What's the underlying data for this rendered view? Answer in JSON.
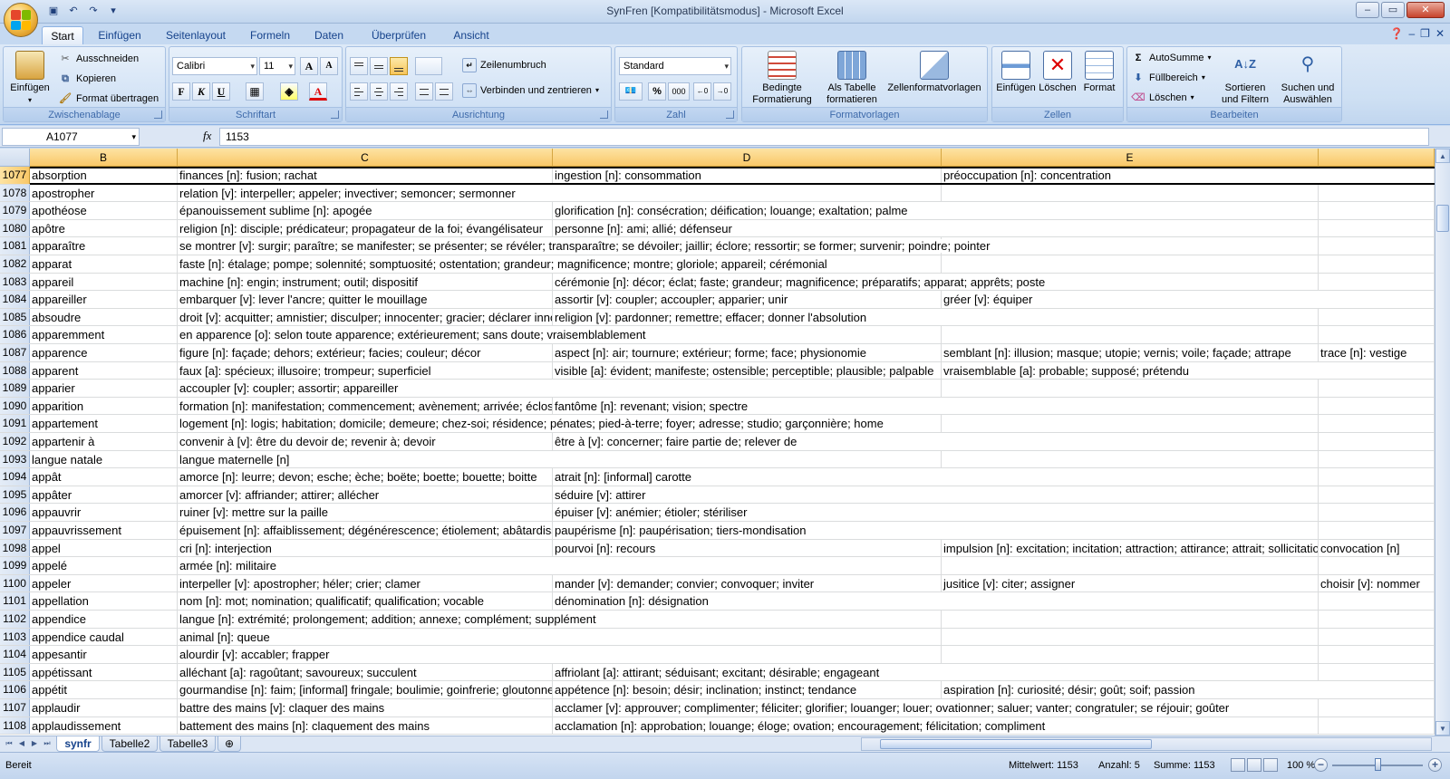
{
  "window": {
    "title": "SynFren  [Kompatibilitätsmodus] - Microsoft Excel"
  },
  "ribbon": {
    "tabs": [
      "Start",
      "Einfügen",
      "Seitenlayout",
      "Formeln",
      "Daten",
      "Überprüfen",
      "Ansicht"
    ],
    "active_tab": "Start",
    "clipboard": {
      "group_label": "Zwischenablage",
      "paste": "Einfügen",
      "cut": "Ausschneiden",
      "copy": "Kopieren",
      "format_painter": "Format übertragen"
    },
    "font": {
      "group_label": "Schriftart",
      "font_name": "Calibri",
      "font_size": "11"
    },
    "alignment": {
      "group_label": "Ausrichtung",
      "wrap_text": "Zeilenumbruch",
      "merge_center": "Verbinden und zentrieren"
    },
    "number": {
      "group_label": "Zahl",
      "format": "Standard",
      "percent": "%",
      "thousands": "000"
    },
    "styles": {
      "group_label": "Formatvorlagen",
      "conditional_line1": "Bedingte",
      "conditional_line2": "Formatierung",
      "as_table_line1": "Als Tabelle",
      "as_table_line2": "formatieren",
      "cell_styles": "Zellenformatvorlagen"
    },
    "cells": {
      "group_label": "Zellen",
      "insert": "Einfügen",
      "delete": "Löschen",
      "format": "Format"
    },
    "editing": {
      "group_label": "Bearbeiten",
      "autosum": "AutoSumme",
      "fill": "Füllbereich",
      "clear": "Löschen",
      "sort_line1": "Sortieren",
      "sort_line2": "und Filtern",
      "find_line1": "Suchen und",
      "find_line2": "Auswählen"
    }
  },
  "formula_bar": {
    "name_box": "A1077",
    "fx": "fx",
    "content": "1153"
  },
  "grid": {
    "columns": [
      "B",
      "C",
      "D",
      "E"
    ],
    "rows": [
      {
        "n": "1077",
        "b": "absorption",
        "c": "finances [n]: fusion; rachat",
        "d": "ingestion [n]: consommation",
        "e": "préoccupation [n]: concentration",
        "f": ""
      },
      {
        "n": "1078",
        "b": "apostropher",
        "c": "relation [v]: interpeller; appeler; invectiver; semoncer; sermonner",
        "d": "",
        "e": "",
        "f": ""
      },
      {
        "n": "1079",
        "b": "apothéose",
        "c": "épanouissement sublime [n]: apogée",
        "d": "glorification [n]: consécration; déification; louange; exaltation; palme",
        "e": "",
        "f": ""
      },
      {
        "n": "1080",
        "b": "apôtre",
        "c": "religion [n]: disciple; prédicateur; propagateur de la foi; évangélisateur",
        "d": "personne [n]: ami; allié; défenseur",
        "e": "",
        "f": ""
      },
      {
        "n": "1081",
        "b": "apparaître",
        "c": "se montrer [v]: surgir; paraître; se manifester; se présenter; se révéler; transparaître; se dévoiler; jaillir; éclore; ressortir; se former; survenir; poindre; pointer",
        "d": "",
        "e": "",
        "f": ""
      },
      {
        "n": "1082",
        "b": "apparat",
        "c": "faste [n]: étalage; pompe; solennité; somptuosité; ostentation; grandeur; magnificence; montre; gloriole; appareil; cérémonial",
        "d": "",
        "e": "",
        "f": ""
      },
      {
        "n": "1083",
        "b": "appareil",
        "c": "machine [n]: engin; instrument; outil; dispositif",
        "d": "cérémonie [n]: décor; éclat; faste; grandeur; magnificence; préparatifs; apparat; apprêts; poste",
        "e": "",
        "f": ""
      },
      {
        "n": "1084",
        "b": "appareiller",
        "c": "embarquer [v]: lever l'ancre; quitter le mouillage",
        "d": "assortir [v]: coupler; accoupler; apparier; unir",
        "e": "gréer [v]: équiper",
        "f": ""
      },
      {
        "n": "1085",
        "b": "absoudre",
        "c": "droit [v]: acquitter; amnistier; disculper; innocenter; gracier; déclarer innocent",
        "d": "religion [v]: pardonner; remettre; effacer; donner l'absolution",
        "e": "",
        "f": ""
      },
      {
        "n": "1086",
        "b": "apparemment",
        "c": "en apparence [o]: selon toute apparence; extérieurement; sans doute; vraisemblablement",
        "d": "",
        "e": "",
        "f": ""
      },
      {
        "n": "1087",
        "b": "apparence",
        "c": "figure [n]: façade; dehors; extérieur; facies; couleur; décor",
        "d": "aspect [n]: air; tournure; extérieur; forme; face; physionomie",
        "e": "semblant [n]: illusion; masque; utopie; vernis; voile; façade; attrape",
        "f": "trace [n]: vestige"
      },
      {
        "n": "1088",
        "b": "apparent",
        "c": "faux [a]: spécieux; illusoire; trompeur; superficiel",
        "d": "visible [a]: évident; manifeste; ostensible; perceptible; plausible; palpable",
        "e": "vraisemblable [a]: probable; supposé; prétendu",
        "f": ""
      },
      {
        "n": "1089",
        "b": "apparier",
        "c": "accoupler [v]: coupler; assortir; appareiller",
        "d": "",
        "e": "",
        "f": ""
      },
      {
        "n": "1090",
        "b": "apparition",
        "c": "formation [n]: manifestation; commencement; avènement; arrivée; éclosion",
        "d": "fantôme [n]: revenant; vision; spectre",
        "e": "",
        "f": ""
      },
      {
        "n": "1091",
        "b": "appartement",
        "c": "logement [n]: logis; habitation; domicile; demeure; chez-soi; résidence; pénates; pied-à-terre; foyer; adresse; studio; garçonnière; home",
        "d": "",
        "e": "",
        "f": ""
      },
      {
        "n": "1092",
        "b": "appartenir à",
        "c": "convenir à [v]: être du devoir de; revenir à; devoir",
        "d": "être à [v]: concerner; faire partie de; relever de",
        "e": "",
        "f": ""
      },
      {
        "n": "1093",
        "b": "langue natale",
        "c": "langue maternelle [n]",
        "d": "",
        "e": "",
        "f": ""
      },
      {
        "n": "1094",
        "b": "appât",
        "c": "amorce [n]: leurre; devon; esche; èche; boëte; boette; bouette; boitte",
        "d": "atrait [n]: [informal] carotte",
        "e": "",
        "f": ""
      },
      {
        "n": "1095",
        "b": "appâter",
        "c": "amorcer [v]: affriander; attirer; allécher",
        "d": "séduire [v]: attirer",
        "e": "",
        "f": ""
      },
      {
        "n": "1096",
        "b": "appauvrir",
        "c": "ruiner [v]: mettre sur la paille",
        "d": "épuiser [v]: anémier; étioler; stériliser",
        "e": "",
        "f": ""
      },
      {
        "n": "1097",
        "b": "appauvrissement",
        "c": "épuisement [n]: affaiblissement; dégénérescence; étiolement; abâtardissement",
        "d": "paupérisme [n]: paupérisation; tiers-mondisation",
        "e": "",
        "f": ""
      },
      {
        "n": "1098",
        "b": "appel",
        "c": "cri [n]: interjection",
        "d": "pourvoi [n]: recours",
        "e": "impulsion [n]: excitation; incitation; attraction; attirance; attrait; sollicitation",
        "f": "convocation [n]"
      },
      {
        "n": "1099",
        "b": "appelé",
        "c": "armée [n]: militaire",
        "d": "",
        "e": "",
        "f": ""
      },
      {
        "n": "1100",
        "b": "appeler",
        "c": "interpeller [v]: apostropher; héler; crier; clamer",
        "d": "mander [v]: demander; convier; convoquer; inviter",
        "e": "jusitice [v]: citer; assigner",
        "f": "choisir [v]: nommer"
      },
      {
        "n": "1101",
        "b": "appellation",
        "c": "nom [n]: mot; nomination; qualificatif; qualification; vocable",
        "d": "dénomination [n]: désignation",
        "e": "",
        "f": ""
      },
      {
        "n": "1102",
        "b": "appendice",
        "c": "langue [n]: extrémité; prolongement; addition; annexe; complément; supplément",
        "d": "",
        "e": "",
        "f": ""
      },
      {
        "n": "1103",
        "b": "appendice caudal",
        "c": "animal [n]: queue",
        "d": "",
        "e": "",
        "f": ""
      },
      {
        "n": "1104",
        "b": "appesantir",
        "c": "alourdir [v]: accabler; frapper",
        "d": "",
        "e": "",
        "f": ""
      },
      {
        "n": "1105",
        "b": "appétissant",
        "c": "alléchant [a]: ragoûtant; savoureux; succulent",
        "d": "affriolant [a]: attirant; séduisant; excitant; désirable; engageant",
        "e": "",
        "f": ""
      },
      {
        "n": "1106",
        "b": "appétit",
        "c": "gourmandise [n]: faim; [informal] fringale; boulimie; goinfrerie; gloutonnerie",
        "d": "appétence [n]: besoin; désir; inclination; instinct; tendance",
        "e": "aspiration [n]: curiosité; désir; goût; soif; passion",
        "f": ""
      },
      {
        "n": "1107",
        "b": "applaudir",
        "c": "battre des mains [v]: claquer des mains",
        "d": "acclamer [v]: approuver; complimenter; féliciter; glorifier; louanger; louer; ovationner; saluer; vanter; congratuler; se réjouir; goûter",
        "e": "",
        "f": ""
      },
      {
        "n": "1108",
        "b": "applaudissement",
        "c": "battement des mains [n]: claquement des mains",
        "d": "acclamation [n]: approbation; louange; éloge; ovation; encouragement; félicitation; compliment",
        "e": "",
        "f": ""
      }
    ]
  },
  "sheets": [
    "synfr",
    "Tabelle2",
    "Tabelle3"
  ],
  "active_sheet": "synfr",
  "status": {
    "ready": "Bereit",
    "average": "Mittelwert: 1153",
    "count": "Anzahl: 5",
    "sum": "Summe: 1153",
    "zoom": "100 %"
  }
}
